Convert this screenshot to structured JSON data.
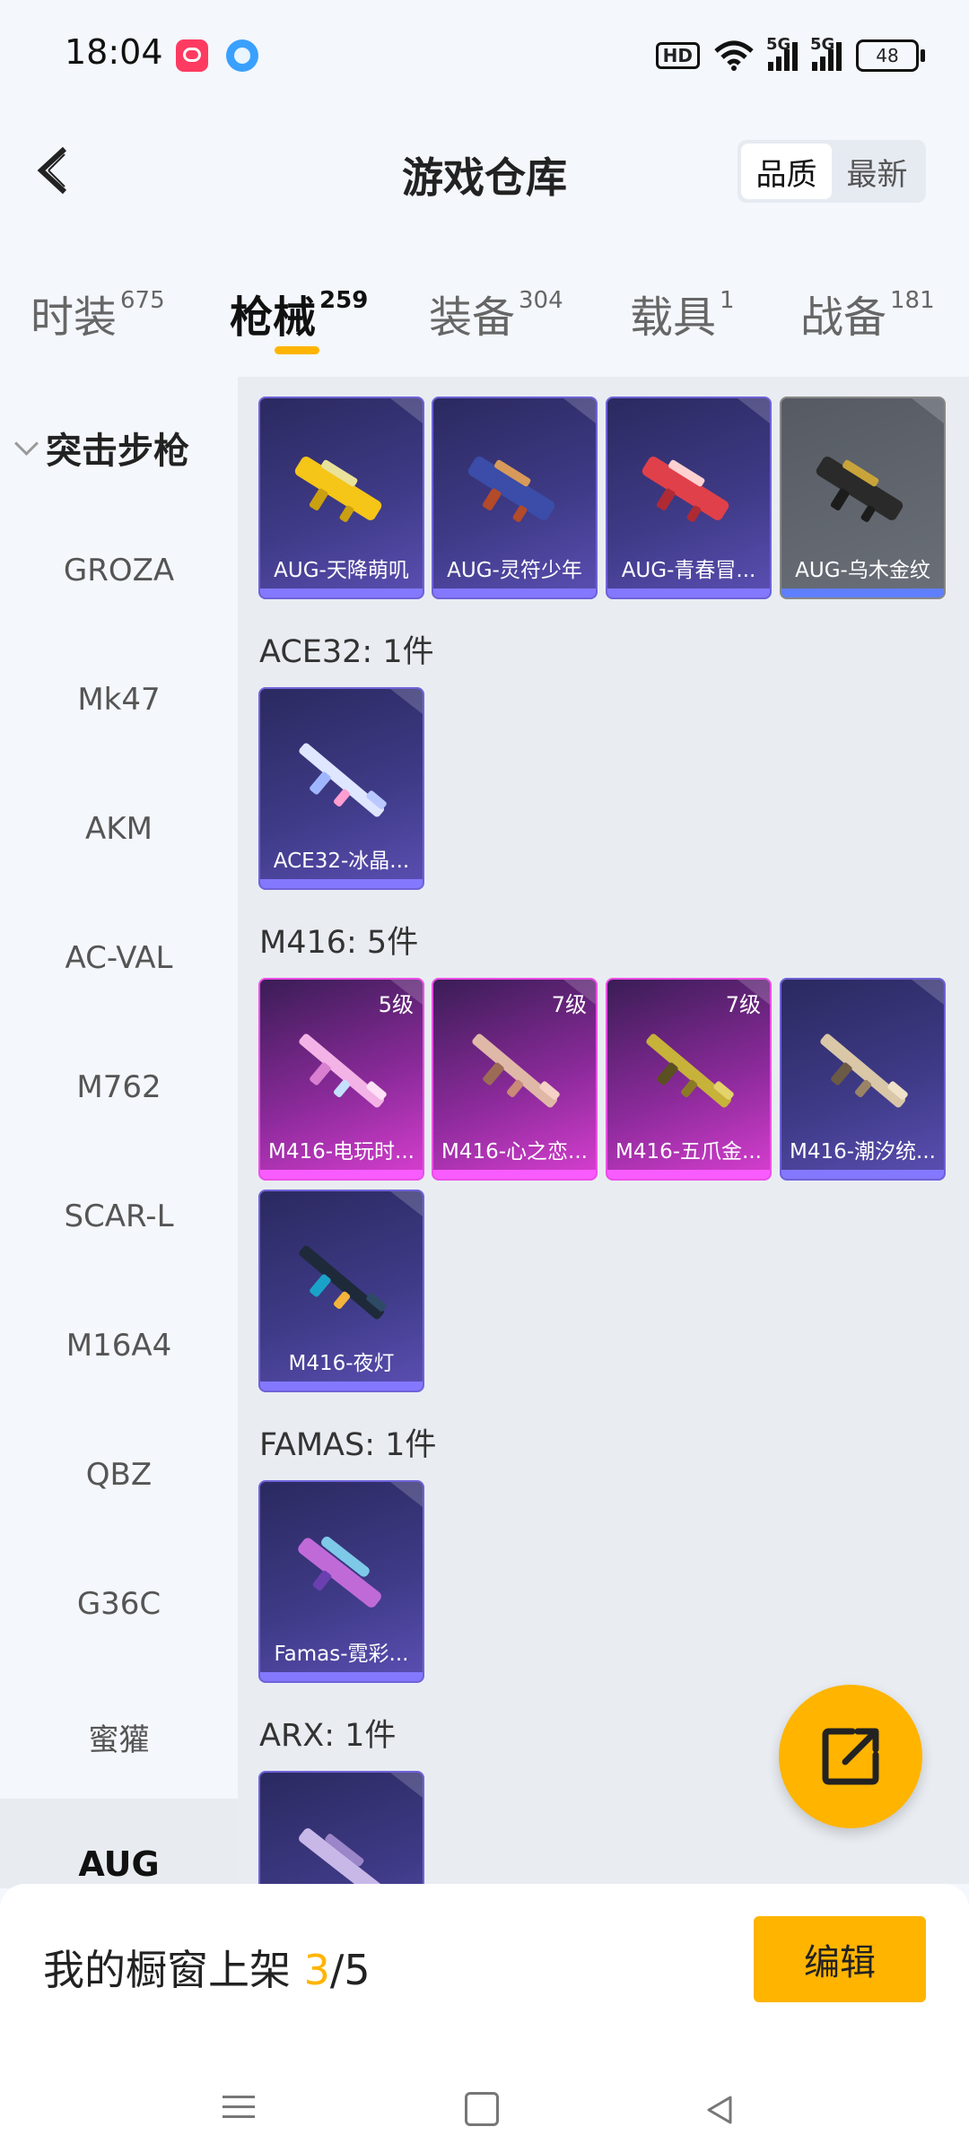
{
  "status_bar": {
    "time": "18:04",
    "hd_label": "HD",
    "signal1_label": "5G",
    "signal2_label": "5G",
    "battery": "48",
    "icons": [
      "app-icon-1",
      "app-icon-2",
      "hd-icon",
      "wifi-icon",
      "signal-icon",
      "battery-icon"
    ]
  },
  "header": {
    "title": "游戏仓库",
    "back_icon": "chevron-left-icon",
    "sort_options": [
      "品质",
      "最新"
    ],
    "sort_selected": "品质"
  },
  "tabs": [
    {
      "label": "时装",
      "count": "675"
    },
    {
      "label": "枪械",
      "count": "259",
      "active": true
    },
    {
      "label": "装备",
      "count": "304"
    },
    {
      "label": "载具",
      "count": "1"
    },
    {
      "label": "战备",
      "count": "181"
    }
  ],
  "sidebar": {
    "category": "突击步枪",
    "items": [
      "GROZA",
      "Mk47",
      "AKM",
      "AC-VAL",
      "M762",
      "SCAR-L",
      "M16A4",
      "QBZ",
      "G36C",
      "蜜獾",
      "AUG"
    ],
    "active_item": "AUG"
  },
  "content": {
    "aug_items": [
      {
        "name": "AUG-天降萌叽",
        "rarity": "purple"
      },
      {
        "name": "AUG-灵符少年",
        "rarity": "purple"
      },
      {
        "name": "AUG-青春冒...",
        "rarity": "purple"
      },
      {
        "name": "AUG-乌木金纹",
        "rarity": "gray"
      }
    ],
    "sections": [
      {
        "label": "ACE32: 1件",
        "items": [
          {
            "name": "ACE32-冰晶...",
            "rarity": "purple"
          }
        ]
      },
      {
        "label": "M416: 5件",
        "items": [
          {
            "name": "M416-电玩时...",
            "rarity": "pink",
            "level": "5级"
          },
          {
            "name": "M416-心之恋...",
            "rarity": "pink",
            "level": "7级"
          },
          {
            "name": "M416-五爪金...",
            "rarity": "pink",
            "level": "7级"
          },
          {
            "name": "M416-潮汐统...",
            "rarity": "purple"
          },
          {
            "name": "M416-夜灯",
            "rarity": "purple"
          }
        ]
      },
      {
        "label": "FAMAS: 1件",
        "items": [
          {
            "name": "Famas-霓彩...",
            "rarity": "purple"
          }
        ]
      },
      {
        "label": "ARX: 1件",
        "items": [
          {
            "name": "",
            "rarity": "purple"
          }
        ]
      }
    ]
  },
  "share_button": {
    "icon": "share-external-icon"
  },
  "bottom_bar": {
    "showcase_prefix": "我的橱窗上架 ",
    "showcase_count": "3",
    "showcase_sep": "/",
    "showcase_total": "5",
    "edit_label": "编辑"
  },
  "nav": {
    "icons": [
      "menu-icon",
      "home-icon",
      "back-icon"
    ]
  },
  "colors": {
    "accent": "#ffb400",
    "purple_rarity": "#6f62d8",
    "pink_rarity": "#ec4fe6"
  }
}
